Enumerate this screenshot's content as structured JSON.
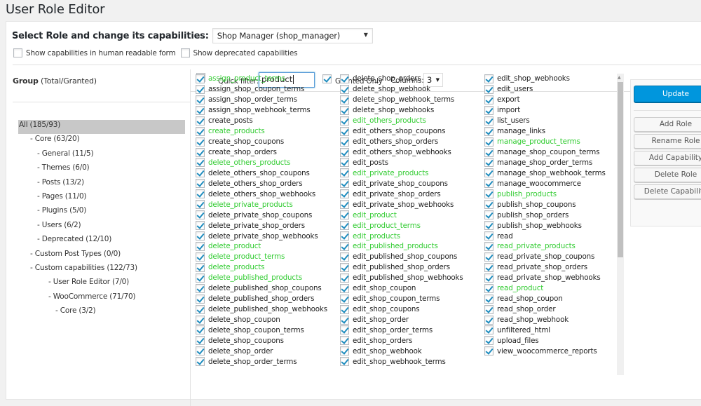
{
  "page": {
    "title": "User Role Editor"
  },
  "role_selector": {
    "label": "Select Role and change its capabilities:",
    "selected": "Shop Manager (shop_manager)"
  },
  "options": {
    "human_readable": {
      "label": "Show capabilities in human readable form",
      "checked": false
    },
    "deprecated": {
      "label": "Show deprecated capabilities",
      "checked": false
    }
  },
  "groups": {
    "header_bold": "Group",
    "header_rest": " (Total/Granted)",
    "items": [
      {
        "label": "All (185/93)",
        "level": 0,
        "selected": true
      },
      {
        "label": "- Core (63/20)",
        "level": 1
      },
      {
        "label": "- General (11/5)",
        "level": 2
      },
      {
        "label": "- Themes (6/0)",
        "level": 2
      },
      {
        "label": "- Posts (13/2)",
        "level": 2
      },
      {
        "label": "- Pages (11/0)",
        "level": 2
      },
      {
        "label": "- Plugins (5/0)",
        "level": 2
      },
      {
        "label": "- Users (6/2)",
        "level": 2
      },
      {
        "label": "- Deprecated (12/10)",
        "level": 2
      },
      {
        "label": "- Custom Post Types (0/0)",
        "level": 1
      },
      {
        "label": "- Custom capabilities (122/73)",
        "level": 1
      },
      {
        "label": "- User Role Editor (7/0)",
        "level": 3
      },
      {
        "label": "- WooCommerce (71/70)",
        "level": 3
      },
      {
        "label": "- Core (3/2)",
        "level": 4
      }
    ]
  },
  "filter_bar": {
    "select_all_checked": false,
    "quick_filter_label": "Quick filter:",
    "quick_filter_value": "product",
    "granted_only_label": "Granted Only",
    "granted_only_checked": true,
    "columns_label": "Columns:",
    "columns_value": "3"
  },
  "colors": {
    "highlight": "#33cc33",
    "accent": "#0096dd",
    "check": "#1e8cbe"
  },
  "capabilities": {
    "columns": [
      [
        {
          "name": "assign_product_terms",
          "checked": true,
          "highlight": true
        },
        {
          "name": "assign_shop_coupon_terms",
          "checked": true,
          "highlight": false
        },
        {
          "name": "assign_shop_order_terms",
          "checked": true,
          "highlight": false
        },
        {
          "name": "assign_shop_webhook_terms",
          "checked": true,
          "highlight": false
        },
        {
          "name": "create_posts",
          "checked": true,
          "highlight": false
        },
        {
          "name": "create_products",
          "checked": true,
          "highlight": true
        },
        {
          "name": "create_shop_coupons",
          "checked": true,
          "highlight": false
        },
        {
          "name": "create_shop_orders",
          "checked": true,
          "highlight": false
        },
        {
          "name": "delete_others_products",
          "checked": true,
          "highlight": true
        },
        {
          "name": "delete_others_shop_coupons",
          "checked": true,
          "highlight": false
        },
        {
          "name": "delete_others_shop_orders",
          "checked": true,
          "highlight": false
        },
        {
          "name": "delete_others_shop_webhooks",
          "checked": true,
          "highlight": false
        },
        {
          "name": "delete_private_products",
          "checked": true,
          "highlight": true
        },
        {
          "name": "delete_private_shop_coupons",
          "checked": true,
          "highlight": false
        },
        {
          "name": "delete_private_shop_orders",
          "checked": true,
          "highlight": false
        },
        {
          "name": "delete_private_shop_webhooks",
          "checked": true,
          "highlight": false
        },
        {
          "name": "delete_product",
          "checked": true,
          "highlight": true
        },
        {
          "name": "delete_product_terms",
          "checked": true,
          "highlight": true
        },
        {
          "name": "delete_products",
          "checked": true,
          "highlight": true
        },
        {
          "name": "delete_published_products",
          "checked": true,
          "highlight": true
        },
        {
          "name": "delete_published_shop_coupons",
          "checked": true,
          "highlight": false
        },
        {
          "name": "delete_published_shop_orders",
          "checked": true,
          "highlight": false
        },
        {
          "name": "delete_published_shop_webhooks",
          "checked": true,
          "highlight": false
        },
        {
          "name": "delete_shop_coupon",
          "checked": true,
          "highlight": false
        },
        {
          "name": "delete_shop_coupon_terms",
          "checked": true,
          "highlight": false
        },
        {
          "name": "delete_shop_coupons",
          "checked": true,
          "highlight": false
        },
        {
          "name": "delete_shop_order",
          "checked": true,
          "highlight": false
        },
        {
          "name": "delete_shop_order_terms",
          "checked": true,
          "highlight": false
        }
      ],
      [
        {
          "name": "delete_shop_orders",
          "checked": true,
          "highlight": false
        },
        {
          "name": "delete_shop_webhook",
          "checked": true,
          "highlight": false
        },
        {
          "name": "delete_shop_webhook_terms",
          "checked": true,
          "highlight": false
        },
        {
          "name": "delete_shop_webhooks",
          "checked": true,
          "highlight": false
        },
        {
          "name": "edit_others_products",
          "checked": true,
          "highlight": true
        },
        {
          "name": "edit_others_shop_coupons",
          "checked": true,
          "highlight": false
        },
        {
          "name": "edit_others_shop_orders",
          "checked": true,
          "highlight": false
        },
        {
          "name": "edit_others_shop_webhooks",
          "checked": true,
          "highlight": false
        },
        {
          "name": "edit_posts",
          "checked": true,
          "highlight": false
        },
        {
          "name": "edit_private_products",
          "checked": true,
          "highlight": true
        },
        {
          "name": "edit_private_shop_coupons",
          "checked": true,
          "highlight": false
        },
        {
          "name": "edit_private_shop_orders",
          "checked": true,
          "highlight": false
        },
        {
          "name": "edit_private_shop_webhooks",
          "checked": true,
          "highlight": false
        },
        {
          "name": "edit_product",
          "checked": true,
          "highlight": true
        },
        {
          "name": "edit_product_terms",
          "checked": true,
          "highlight": true
        },
        {
          "name": "edit_products",
          "checked": true,
          "highlight": true
        },
        {
          "name": "edit_published_products",
          "checked": true,
          "highlight": true
        },
        {
          "name": "edit_published_shop_coupons",
          "checked": true,
          "highlight": false
        },
        {
          "name": "edit_published_shop_orders",
          "checked": true,
          "highlight": false
        },
        {
          "name": "edit_published_shop_webhooks",
          "checked": true,
          "highlight": false
        },
        {
          "name": "edit_shop_coupon",
          "checked": true,
          "highlight": false
        },
        {
          "name": "edit_shop_coupon_terms",
          "checked": true,
          "highlight": false
        },
        {
          "name": "edit_shop_coupons",
          "checked": true,
          "highlight": false
        },
        {
          "name": "edit_shop_order",
          "checked": true,
          "highlight": false
        },
        {
          "name": "edit_shop_order_terms",
          "checked": true,
          "highlight": false
        },
        {
          "name": "edit_shop_orders",
          "checked": true,
          "highlight": false
        },
        {
          "name": "edit_shop_webhook",
          "checked": true,
          "highlight": false
        },
        {
          "name": "edit_shop_webhook_terms",
          "checked": true,
          "highlight": false
        }
      ],
      [
        {
          "name": "edit_shop_webhooks",
          "checked": true,
          "highlight": false
        },
        {
          "name": "edit_users",
          "checked": true,
          "highlight": false
        },
        {
          "name": "export",
          "checked": true,
          "highlight": false
        },
        {
          "name": "import",
          "checked": true,
          "highlight": false
        },
        {
          "name": "list_users",
          "checked": true,
          "highlight": false
        },
        {
          "name": "manage_links",
          "checked": true,
          "highlight": false
        },
        {
          "name": "manage_product_terms",
          "checked": true,
          "highlight": true
        },
        {
          "name": "manage_shop_coupon_terms",
          "checked": true,
          "highlight": false
        },
        {
          "name": "manage_shop_order_terms",
          "checked": true,
          "highlight": false
        },
        {
          "name": "manage_shop_webhook_terms",
          "checked": true,
          "highlight": false
        },
        {
          "name": "manage_woocommerce",
          "checked": true,
          "highlight": false
        },
        {
          "name": "publish_products",
          "checked": true,
          "highlight": true
        },
        {
          "name": "publish_shop_coupons",
          "checked": true,
          "highlight": false
        },
        {
          "name": "publish_shop_orders",
          "checked": true,
          "highlight": false
        },
        {
          "name": "publish_shop_webhooks",
          "checked": true,
          "highlight": false
        },
        {
          "name": "read",
          "checked": true,
          "highlight": false
        },
        {
          "name": "read_private_products",
          "checked": true,
          "highlight": true
        },
        {
          "name": "read_private_shop_coupons",
          "checked": true,
          "highlight": false
        },
        {
          "name": "read_private_shop_orders",
          "checked": true,
          "highlight": false
        },
        {
          "name": "read_private_shop_webhooks",
          "checked": true,
          "highlight": false
        },
        {
          "name": "read_product",
          "checked": true,
          "highlight": true
        },
        {
          "name": "read_shop_coupon",
          "checked": true,
          "highlight": false
        },
        {
          "name": "read_shop_order",
          "checked": true,
          "highlight": false
        },
        {
          "name": "read_shop_webhook",
          "checked": true,
          "highlight": false
        },
        {
          "name": "unfiltered_html",
          "checked": true,
          "highlight": false
        },
        {
          "name": "upload_files",
          "checked": true,
          "highlight": false
        },
        {
          "name": "view_woocommerce_reports",
          "checked": true,
          "highlight": false
        }
      ]
    ]
  },
  "actions": {
    "update": "Update",
    "buttons": [
      "Add Role",
      "Rename Role",
      "Add Capability",
      "Delete Role",
      "Delete Capability"
    ]
  }
}
